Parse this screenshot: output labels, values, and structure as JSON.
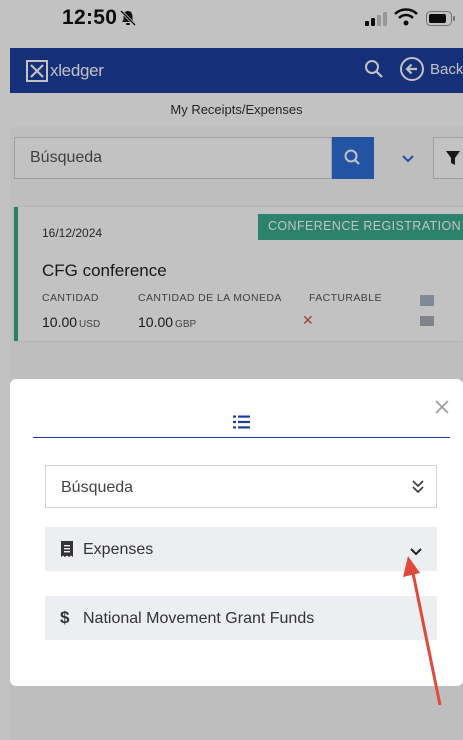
{
  "status": {
    "time": "12:50"
  },
  "nav": {
    "logo_text": "xledger",
    "back_label": "Back"
  },
  "page": {
    "subtitle": "My Receipts/Expenses"
  },
  "search": {
    "placeholder": "Búsqueda"
  },
  "card": {
    "date": "16/12/2024",
    "category": "CONFERENCE REGISTRATION",
    "title": "CFG conference",
    "amount_label": "CANTIDAD",
    "amount_value": "10.00",
    "amount_currency": "USD",
    "currency_amount_label": "CANTIDAD DE LA MONEDA",
    "currency_amount_value": "10.00",
    "currency_amount_currency": "GBP",
    "billable_label": "FACTURABLE",
    "billable_value": "✕"
  },
  "modal": {
    "search_placeholder": "Búsqueda",
    "items": [
      {
        "label": "Expenses",
        "icon": "receipt-icon"
      },
      {
        "label": "National Movement Grant Funds",
        "icon": "dollar-icon"
      }
    ]
  },
  "colors": {
    "nav_blue": "#1c3ea0",
    "search_blue": "#2f6fd8",
    "badge_green": "#3bab8f",
    "arrow_red": "#e04a3c"
  }
}
